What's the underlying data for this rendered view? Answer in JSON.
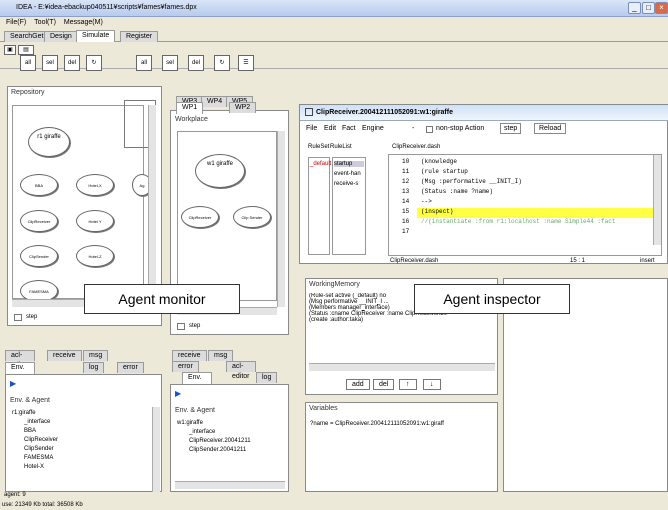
{
  "window": {
    "title": "IDEA - E:¥idea-ebackup040511¥scripts¥fames¥fames.dpx"
  },
  "menu": [
    "File(F)",
    "Tool(T)",
    "Message(M)"
  ],
  "tabs": [
    "SearchGet",
    "Design",
    "Simulate",
    "Register"
  ],
  "repository": {
    "title": "Repository",
    "agent": "r1\ngiraffe",
    "nodes": [
      "BBA",
      "Hotel-X",
      "Ag",
      "ClipReceiver",
      "Hotel Y",
      "ClipSender",
      "Hotel-Z",
      "FAMESMA"
    ],
    "step": "step"
  },
  "workplace": {
    "tabs_top": [
      "WP3",
      "WP4",
      "WP5"
    ],
    "tabs": [
      "WP1",
      "WP2"
    ],
    "title": "Workplace",
    "agent": "w1\ngiraffe",
    "nodes": [
      "ClipReceiver",
      "Clip Sender"
    ],
    "step": "step"
  },
  "inspector": {
    "title": "ClipReceiver.200412111052091:w1:giraffe",
    "menu": [
      "File",
      "Edit",
      "Fact",
      "Engine",
      "-",
      "non-stop Action",
      "step",
      "Reload"
    ],
    "ruleset": "RuleSet",
    "rulelist": "RuleList",
    "ruleset_item": "_default",
    "rulelist_items": [
      "startup",
      "event-han",
      "receive-s"
    ],
    "editor_title": "ClipReceiver.dash",
    "lines": [
      [
        "10",
        "(knowledge"
      ],
      [
        "11",
        "  (rule startup"
      ],
      [
        "12",
        "    (Msg :performative __INIT_I)"
      ],
      [
        "13",
        "    (Status :name ?name)"
      ],
      [
        "14",
        "    -->"
      ],
      [
        "15",
        "    (inspect)"
      ],
      [
        "16",
        "    //(instantiate :from r1:localhost :name Simple44 :fact"
      ],
      [
        "17",
        ""
      ]
    ],
    "editor_status": "ClipReceiver.dash",
    "pos": "15 : 1",
    "mode": "insert"
  },
  "workingmemory": {
    "title": "WorkingMemory",
    "items": [
      "(Rule-set active (_default) no",
      "(Msg performative __INIT_I ...",
      "(Members manager_interface)",
      "(Status :cname ClipReceiver :name ClipReceiver.20",
      "(create :author:taka)"
    ],
    "buttons": [
      "add",
      "del",
      "↑",
      "↓"
    ]
  },
  "variables": {
    "title": "Variables",
    "value": "?name = ClipReceiver.200412111052091:w1:giraff"
  },
  "left_bottom": {
    "tabs1": [
      "acl-editor",
      "receive",
      "msg"
    ],
    "tabs2": [
      "Env. & Agent",
      "log",
      "error"
    ],
    "title": "Env. & Agent",
    "tree": [
      "r1:giraffe",
      "_interface",
      "BBA",
      "ClipReceiver",
      "ClipSender",
      "FAMESMA",
      "Hotel-X"
    ],
    "agent_count": "agent: 9"
  },
  "mid_bottom": {
    "tabs1": [
      "receive",
      "msg"
    ],
    "tabs2": [
      "error",
      "acl-editor"
    ],
    "tabs3": [
      "Env. & Agent",
      "log"
    ],
    "title": "Env. & Agent",
    "tree": [
      "w1:giraffe",
      "_interface",
      "ClipReceiver.20041211",
      "ClipSender.20041211"
    ]
  },
  "labels": {
    "monitor": "Agent monitor",
    "inspector": "Agent inspector"
  },
  "status": "use: 21349 Kb   total: 36508 Kb"
}
